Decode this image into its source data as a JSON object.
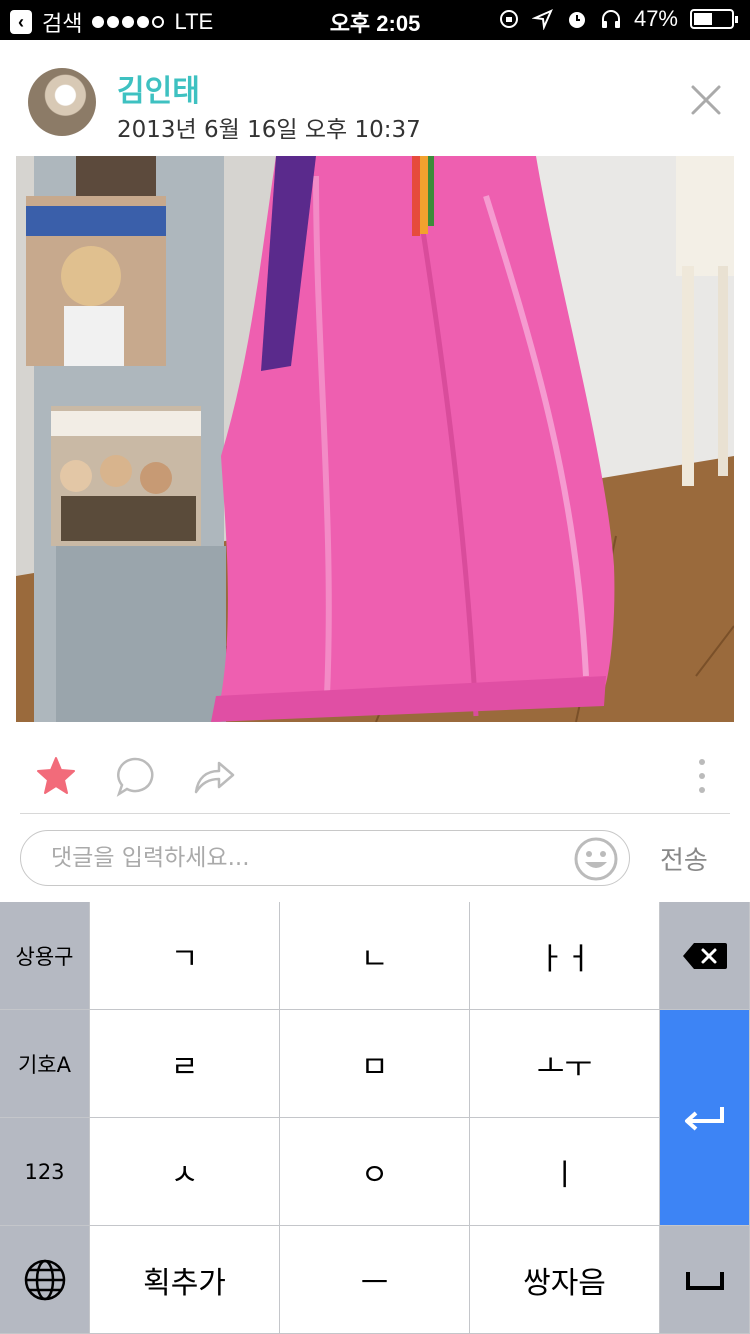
{
  "status_bar": {
    "back_label": "검색",
    "carrier": "LTE",
    "time": "오후 2:05",
    "battery": "47%",
    "battery_level": 0.47
  },
  "post": {
    "author": "김인태",
    "date": "2013년 6월 16일 오후 10:37"
  },
  "comment": {
    "placeholder": "댓글을 입력하세요...",
    "send_label": "전송"
  },
  "keyboard": {
    "side_keys": [
      "상용구",
      "기호A",
      "123"
    ],
    "rows": [
      [
        "ㄱ",
        "ㄴ",
        "ㅏㅓ"
      ],
      [
        "ㄹ",
        "ㅁ",
        "ㅗㅜ"
      ],
      [
        "ㅅ",
        "ㅇ",
        "ㅣ"
      ],
      [
        "획추가",
        "ㅡ",
        "쌍자음"
      ]
    ]
  },
  "colors": {
    "accent": "#3ec1c1",
    "star": "#f26b7a",
    "enter_key": "#3d84f5",
    "skirt_pink": "#ee5fb0"
  }
}
